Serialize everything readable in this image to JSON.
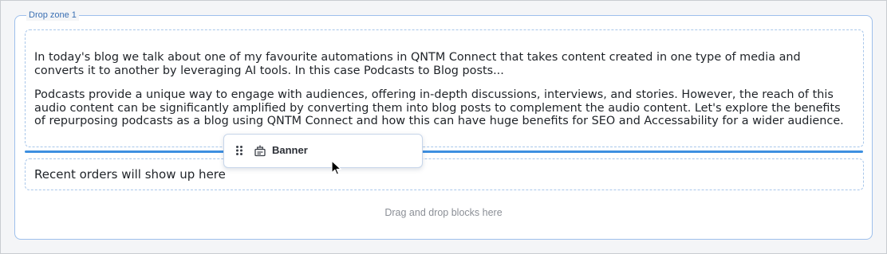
{
  "drop_zone": {
    "label": "Drop zone 1",
    "placeholder": "Drag and drop blocks here"
  },
  "text_block": {
    "paragraph_1": "In today's blog we talk about one of my favourite automations in QNTM Connect that takes content created in one type of media and converts it to another by leveraging AI tools. In this case Podcasts to Blog posts...",
    "paragraph_2": "Podcasts provide a unique way to engage with audiences, offering in-depth discussions, interviews, and stories. However, the reach of this audio content can be significantly amplified by converting them into blog posts to complement the audio content. Let's explore the benefits of repurposing podcasts as a blog using QNTM Connect and how this can have huge benefits for SEO and Accessability for a wider audience."
  },
  "orders_block": {
    "text": "Recent orders will show up here"
  },
  "dragged_block": {
    "label": "Banner",
    "icon": "banner-icon"
  },
  "colors": {
    "accent": "#3d8fe0",
    "border": "#9ec0ec"
  }
}
